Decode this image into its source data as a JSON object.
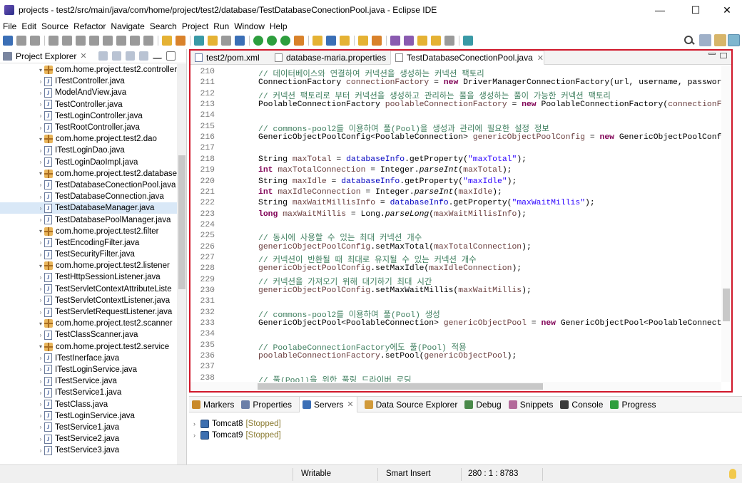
{
  "window": {
    "title": "projects - test2/src/main/java/com/home/project/test2/database/TestDatabaseConectionPool.java - Eclipse IDE"
  },
  "window_controls": {
    "minimize": "—",
    "maximize": "☐",
    "close": "✕"
  },
  "menu": [
    "File",
    "Edit",
    "Source",
    "Refactor",
    "Navigate",
    "Search",
    "Project",
    "Run",
    "Window",
    "Help"
  ],
  "project_explorer": {
    "title": "Project Explorer",
    "items": [
      {
        "kind": "package",
        "label": "com.home.project.test2.controller"
      },
      {
        "kind": "interface",
        "label": "ITestController.java"
      },
      {
        "kind": "class",
        "label": "ModelAndView.java"
      },
      {
        "kind": "class",
        "label": "TestController.java"
      },
      {
        "kind": "class",
        "label": "TestLoginController.java"
      },
      {
        "kind": "class",
        "label": "TestRootController.java"
      },
      {
        "kind": "package",
        "label": "com.home.project.test2.dao"
      },
      {
        "kind": "interface",
        "label": "ITestLoginDao.java"
      },
      {
        "kind": "class",
        "label": "TestLoginDaoImpl.java"
      },
      {
        "kind": "package",
        "label": "com.home.project.test2.database"
      },
      {
        "kind": "class",
        "label": "TestDatabaseConectionPool.java"
      },
      {
        "kind": "class",
        "label": "TestDatabaseConnection.java"
      },
      {
        "kind": "class",
        "label": "TestDatabaseManager.java"
      },
      {
        "kind": "class",
        "label": "TestDatabasePoolManager.java"
      },
      {
        "kind": "package",
        "label": "com.home.project.test2.filter"
      },
      {
        "kind": "class",
        "label": "TestEncodingFilter.java"
      },
      {
        "kind": "class",
        "label": "TestSecurityFilter.java"
      },
      {
        "kind": "package",
        "label": "com.home.project.test2.listener"
      },
      {
        "kind": "class",
        "label": "TestHttpSessionListener.java"
      },
      {
        "kind": "class",
        "label": "TestServletContextAttributeListe"
      },
      {
        "kind": "class",
        "label": "TestServletContextListener.java"
      },
      {
        "kind": "class",
        "label": "TestServletRequestListener.java"
      },
      {
        "kind": "package",
        "label": "com.home.project.test2.scanner"
      },
      {
        "kind": "class",
        "label": "TestClassScanner.java"
      },
      {
        "kind": "package",
        "label": "com.home.project.test2.service"
      },
      {
        "kind": "interface",
        "label": "ITestInerface.java"
      },
      {
        "kind": "interface",
        "label": "ITestLoginService.java"
      },
      {
        "kind": "interface",
        "label": "ITestService.java"
      },
      {
        "kind": "interface",
        "label": "ITestService1.java"
      },
      {
        "kind": "class",
        "label": "TestClass.java"
      },
      {
        "kind": "class",
        "label": "TestLoginService.java"
      },
      {
        "kind": "class",
        "label": "TestService1.java"
      },
      {
        "kind": "class",
        "label": "TestService2.java"
      },
      {
        "kind": "class",
        "label": "TestService3.java"
      }
    ]
  },
  "editor": {
    "tabs": [
      {
        "label": "test2/pom.xml",
        "active": false
      },
      {
        "label": "database-maria.properties",
        "active": false
      },
      {
        "label": "TestDatabaseConectionPool.java",
        "active": true
      }
    ],
    "lines": [
      {
        "n": "210",
        "code": [
          {
            "c": "cm",
            "t": "// 데이터베이스와 연결하여 커넥션을 생성하는 커넥션 팩토리"
          }
        ]
      },
      {
        "n": "211",
        "code": [
          {
            "t": "ConnectionFactory "
          },
          {
            "c": "vr",
            "t": "connectionFactory"
          },
          {
            "t": " = "
          },
          {
            "c": "kw",
            "t": "new"
          },
          {
            "t": " DriverManagerConnectionFactory(url, username, password);"
          }
        ]
      },
      {
        "n": "212",
        "code": [
          {
            "c": "cm",
            "t": "// 커넥션 팩토리로 부터 커넥션을 생성하고 관리하는 풀을 생성하는 풀이 가능한 커넥션 팩토리"
          }
        ]
      },
      {
        "n": "213",
        "code": [
          {
            "t": "PoolableConnectionFactory "
          },
          {
            "c": "vr",
            "t": "poolableConnectionFactory"
          },
          {
            "t": " = "
          },
          {
            "c": "kw",
            "t": "new"
          },
          {
            "t": " PoolableConnectionFactory("
          },
          {
            "c": "vr",
            "t": "connectionFactory"
          },
          {
            "t": ", null);"
          }
        ]
      },
      {
        "n": "214",
        "code": []
      },
      {
        "n": "215",
        "code": [
          {
            "c": "cm",
            "t": "// commons-pool2를 이용하여 풀(Pool)을 생성과 관리에 필요한 설정 정보"
          }
        ]
      },
      {
        "n": "216",
        "code": [
          {
            "t": "GenericObjectPoolConfig<PoolableConnection> "
          },
          {
            "c": "vr",
            "t": "genericObjectPoolConfig"
          },
          {
            "t": " = "
          },
          {
            "c": "kw",
            "t": "new"
          },
          {
            "t": " GenericObjectPoolConfig<>();"
          }
        ]
      },
      {
        "n": "217",
        "code": []
      },
      {
        "n": "218",
        "code": [
          {
            "t": "String "
          },
          {
            "c": "vr",
            "t": "maxTotal"
          },
          {
            "t": " = "
          },
          {
            "c": "fd",
            "t": "databaseInfo"
          },
          {
            "t": ".getProperty("
          },
          {
            "c": "st",
            "t": "\"maxTotal\""
          },
          {
            "t": ");"
          }
        ]
      },
      {
        "n": "219",
        "code": [
          {
            "c": "kw",
            "t": "int"
          },
          {
            "t": " "
          },
          {
            "c": "vr",
            "t": "maxTotalConnection"
          },
          {
            "t": " = Integer."
          },
          {
            "c": "it",
            "t": "parseInt"
          },
          {
            "t": "("
          },
          {
            "c": "vr",
            "t": "maxTotal"
          },
          {
            "t": ");"
          }
        ]
      },
      {
        "n": "220",
        "code": [
          {
            "t": "String "
          },
          {
            "c": "vr",
            "t": "maxIdle"
          },
          {
            "t": " = "
          },
          {
            "c": "fd",
            "t": "databaseInfo"
          },
          {
            "t": ".getProperty("
          },
          {
            "c": "st",
            "t": "\"maxIdle\""
          },
          {
            "t": ");"
          }
        ]
      },
      {
        "n": "221",
        "code": [
          {
            "c": "kw",
            "t": "int"
          },
          {
            "t": " "
          },
          {
            "c": "vr",
            "t": "maxIdleConnection"
          },
          {
            "t": " = Integer."
          },
          {
            "c": "it",
            "t": "parseInt"
          },
          {
            "t": "("
          },
          {
            "c": "vr",
            "t": "maxIdle"
          },
          {
            "t": ");"
          }
        ]
      },
      {
        "n": "222",
        "code": [
          {
            "t": "String "
          },
          {
            "c": "vr",
            "t": "maxWaitMillisInfo"
          },
          {
            "t": " = "
          },
          {
            "c": "fd",
            "t": "databaseInfo"
          },
          {
            "t": ".getProperty("
          },
          {
            "c": "st",
            "t": "\"maxWaitMillis\""
          },
          {
            "t": ");"
          }
        ]
      },
      {
        "n": "223",
        "code": [
          {
            "c": "kw",
            "t": "long"
          },
          {
            "t": " "
          },
          {
            "c": "vr",
            "t": "maxWaitMillis"
          },
          {
            "t": " = Long."
          },
          {
            "c": "it",
            "t": "parseLong"
          },
          {
            "t": "("
          },
          {
            "c": "vr",
            "t": "maxWaitMillisInfo"
          },
          {
            "t": ");"
          }
        ]
      },
      {
        "n": "224",
        "code": []
      },
      {
        "n": "225",
        "code": [
          {
            "c": "cm",
            "t": "// 동시에 사용할 수 있는 최대 커넥션 개수"
          }
        ]
      },
      {
        "n": "226",
        "code": [
          {
            "c": "vr",
            "t": "genericObjectPoolConfig"
          },
          {
            "t": ".setMaxTotal("
          },
          {
            "c": "vr",
            "t": "maxTotalConnection"
          },
          {
            "t": ");"
          }
        ]
      },
      {
        "n": "227",
        "code": [
          {
            "c": "cm",
            "t": "// 커넥션이 반환될 때 최대로 유지될 수 있는 커넥션 개수"
          }
        ]
      },
      {
        "n": "228",
        "code": [
          {
            "c": "vr",
            "t": "genericObjectPoolConfig"
          },
          {
            "t": ".setMaxIdle("
          },
          {
            "c": "vr",
            "t": "maxIdleConnection"
          },
          {
            "t": ");"
          }
        ]
      },
      {
        "n": "229",
        "code": [
          {
            "c": "cm",
            "t": "// 커넥션을 가져오기 위해 대기하기 최대 시간"
          }
        ]
      },
      {
        "n": "230",
        "code": [
          {
            "c": "vr",
            "t": "genericObjectPoolConfig"
          },
          {
            "t": ".setMaxWaitMillis("
          },
          {
            "c": "vr",
            "t": "maxWaitMillis"
          },
          {
            "t": ");"
          }
        ]
      },
      {
        "n": "231",
        "code": []
      },
      {
        "n": "232",
        "code": [
          {
            "c": "cm",
            "t": "// commons-pool2를 이용하여 풀(Pool) 생성"
          }
        ]
      },
      {
        "n": "233",
        "code": [
          {
            "t": "GenericObjectPool<PoolableConnection> "
          },
          {
            "c": "vr",
            "t": "genericObjectPool"
          },
          {
            "t": " = "
          },
          {
            "c": "kw",
            "t": "new"
          },
          {
            "t": " GenericObjectPool<PoolableConnection>("
          }
        ]
      },
      {
        "n": "234",
        "code": []
      },
      {
        "n": "235",
        "code": [
          {
            "c": "cm",
            "t": "// PoolabeConnectionFactory에도 풀(Pool) 적용"
          }
        ]
      },
      {
        "n": "236",
        "code": [
          {
            "c": "vr",
            "t": "poolableConnectionFactory"
          },
          {
            "t": ".setPool("
          },
          {
            "c": "vr",
            "t": "genericObjectPool"
          },
          {
            "t": ");"
          }
        ]
      },
      {
        "n": "237",
        "code": []
      },
      {
        "n": "238",
        "code": [
          {
            "c": "cm",
            "t": "// 풀(Pool)을 위한 풀링 드라이버 로딩"
          }
        ]
      }
    ]
  },
  "bottom_panel": {
    "tabs": [
      {
        "label": "Markers",
        "icon": "markers-icon",
        "active": false
      },
      {
        "label": "Properties",
        "icon": "properties-icon",
        "active": false
      },
      {
        "label": "Servers",
        "icon": "servers-icon",
        "active": true
      },
      {
        "label": "Data Source Explorer",
        "icon": "data-source-icon",
        "active": false
      },
      {
        "label": "Debug",
        "icon": "debug-icon",
        "active": false
      },
      {
        "label": "Snippets",
        "icon": "snippets-icon",
        "active": false
      },
      {
        "label": "Console",
        "icon": "console-icon",
        "active": false
      },
      {
        "label": "Progress",
        "icon": "progress-icon",
        "active": false
      }
    ],
    "servers": [
      {
        "name": "Tomcat8",
        "state": "[Stopped]"
      },
      {
        "name": "Tomcat9",
        "state": "[Stopped]"
      }
    ]
  },
  "status_bar": {
    "mode": "Writable",
    "insert": "Smart Insert",
    "position": "280 : 1 : 8783"
  },
  "colors": {
    "editor_highlight_border": "#d0172a",
    "comment": "#3f7f5f",
    "keyword": "#7f0055",
    "string": "#2a00ff",
    "field": "#0000c0",
    "stopped": "#8a7a30"
  }
}
